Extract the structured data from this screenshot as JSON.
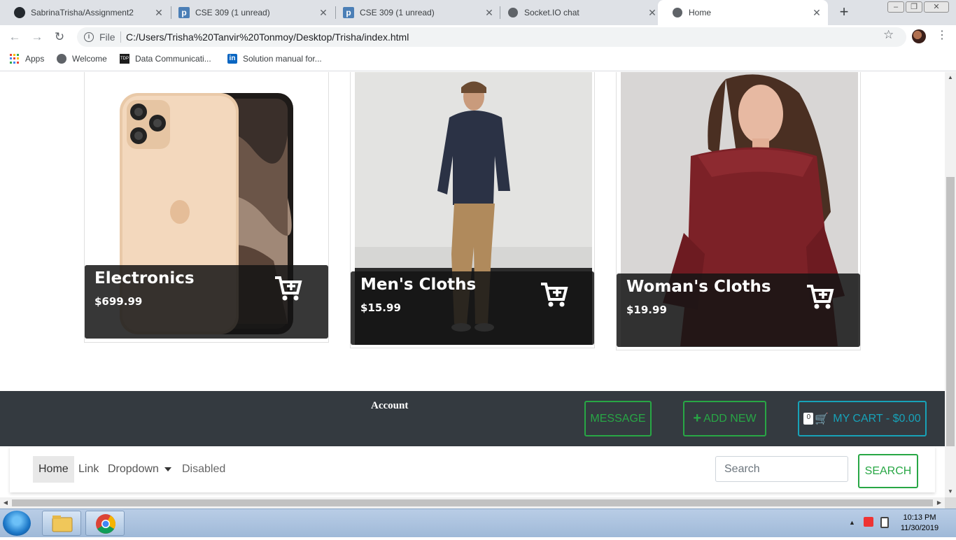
{
  "browser": {
    "tabs": [
      {
        "title": "SabrinaTrisha/Assignment2",
        "icon": "github-icon"
      },
      {
        "title": "CSE 309 (1 unread)",
        "icon": "piazza-icon"
      },
      {
        "title": "CSE 309 (1 unread)",
        "icon": "piazza-icon"
      },
      {
        "title": "Socket.IO chat",
        "icon": "globe-icon"
      },
      {
        "title": "Home",
        "icon": "globe-icon"
      }
    ],
    "file_label": "File",
    "url": "C:/Users/Trisha%20Tanvir%20Tonmoy/Desktop/Trisha/index.html",
    "bookmarks": [
      {
        "label": "Apps"
      },
      {
        "label": "Welcome"
      },
      {
        "label": "Data Communicati..."
      },
      {
        "label": "Solution manual for..."
      }
    ]
  },
  "products": [
    {
      "category": "Electronics",
      "price": "$699.99",
      "icon": "add-to-cart-icon"
    },
    {
      "category": "Men's Cloths",
      "price": "$15.99",
      "icon": "add-to-cart-icon"
    },
    {
      "category": "Woman's Cloths",
      "price": "$19.99",
      "icon": "add-to-cart-icon"
    }
  ],
  "footer": {
    "account_label": "Account",
    "message_label": "MESSAGE",
    "add_new_label": "ADD NEW",
    "cart_label": "MY CART - $0.00",
    "cart_badge": "0"
  },
  "nav": {
    "items": [
      {
        "label": "Home"
      },
      {
        "label": "Link"
      },
      {
        "label": "Dropdown"
      },
      {
        "label": "Disabled"
      }
    ],
    "search_placeholder": "Search",
    "search_button": "SEARCH"
  },
  "taskbar": {
    "time": "10:13 PM",
    "date": "11/30/2019"
  },
  "colors": {
    "success": "#28a745",
    "info": "#17a2b8",
    "dark": "#343a40"
  }
}
